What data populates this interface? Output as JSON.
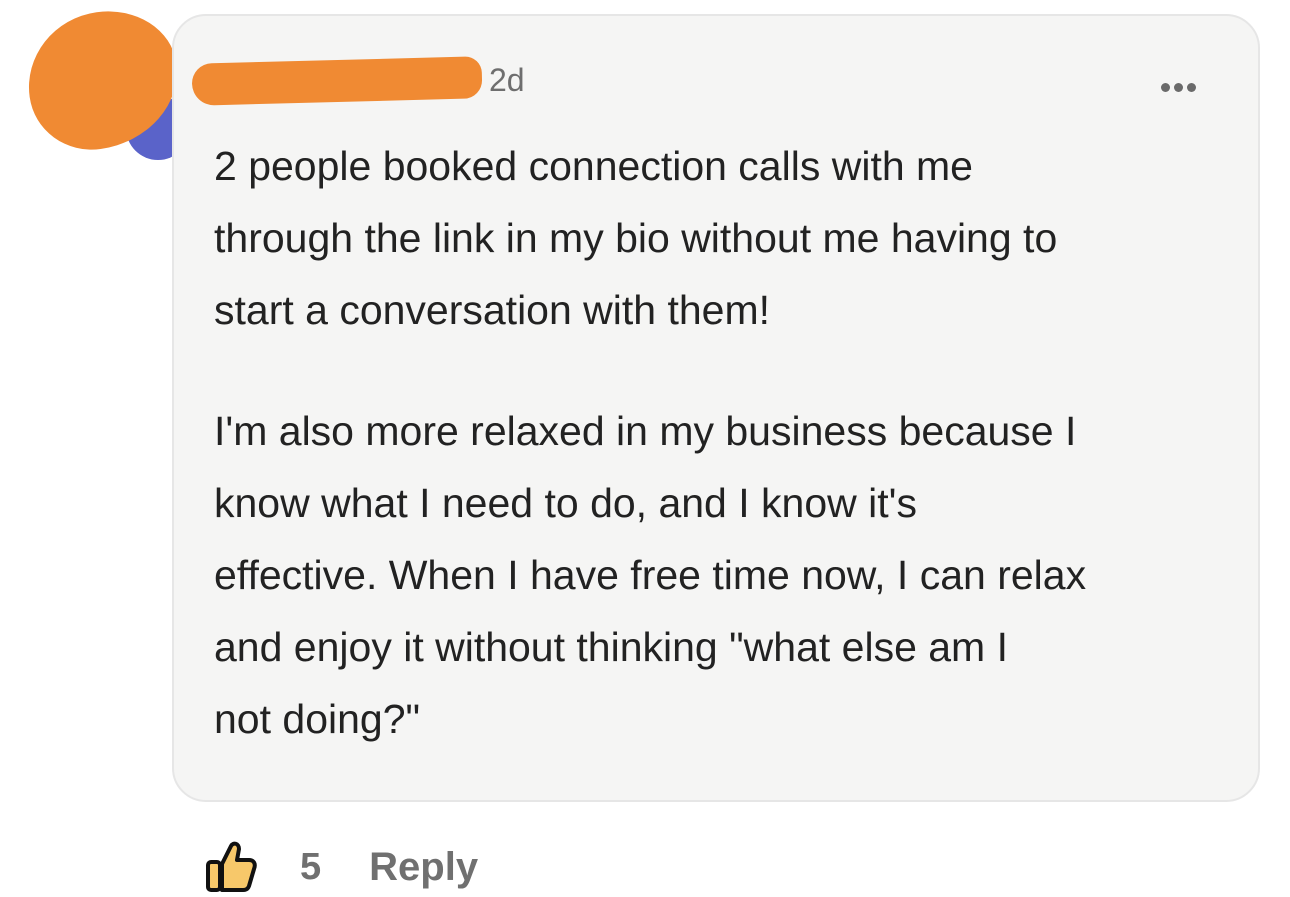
{
  "comment": {
    "author": "",
    "timestamp": "2d",
    "paragraphs": [
      "2 people booked connection calls with me\nthrough the link in my bio without me having to\nstart a conversation with them!",
      "I'm also more relaxed in my business because I\nknow what I need to do, and I know it's\neffective. When I have free time now, I can relax\nand enjoy it without thinking \"what else am I\nnot doing?\""
    ],
    "likes": "5",
    "reply_label": "Reply"
  },
  "icons": {
    "more": "more-horizontal-icon",
    "like": "thumbs-up-icon"
  },
  "colors": {
    "bubble_bg": "#f5f5f4",
    "redaction": "#f08a33",
    "avatar_ring": "#5a63c9",
    "muted_text": "#707070",
    "body_text": "#222222",
    "like_fill": "#f7c86a"
  }
}
